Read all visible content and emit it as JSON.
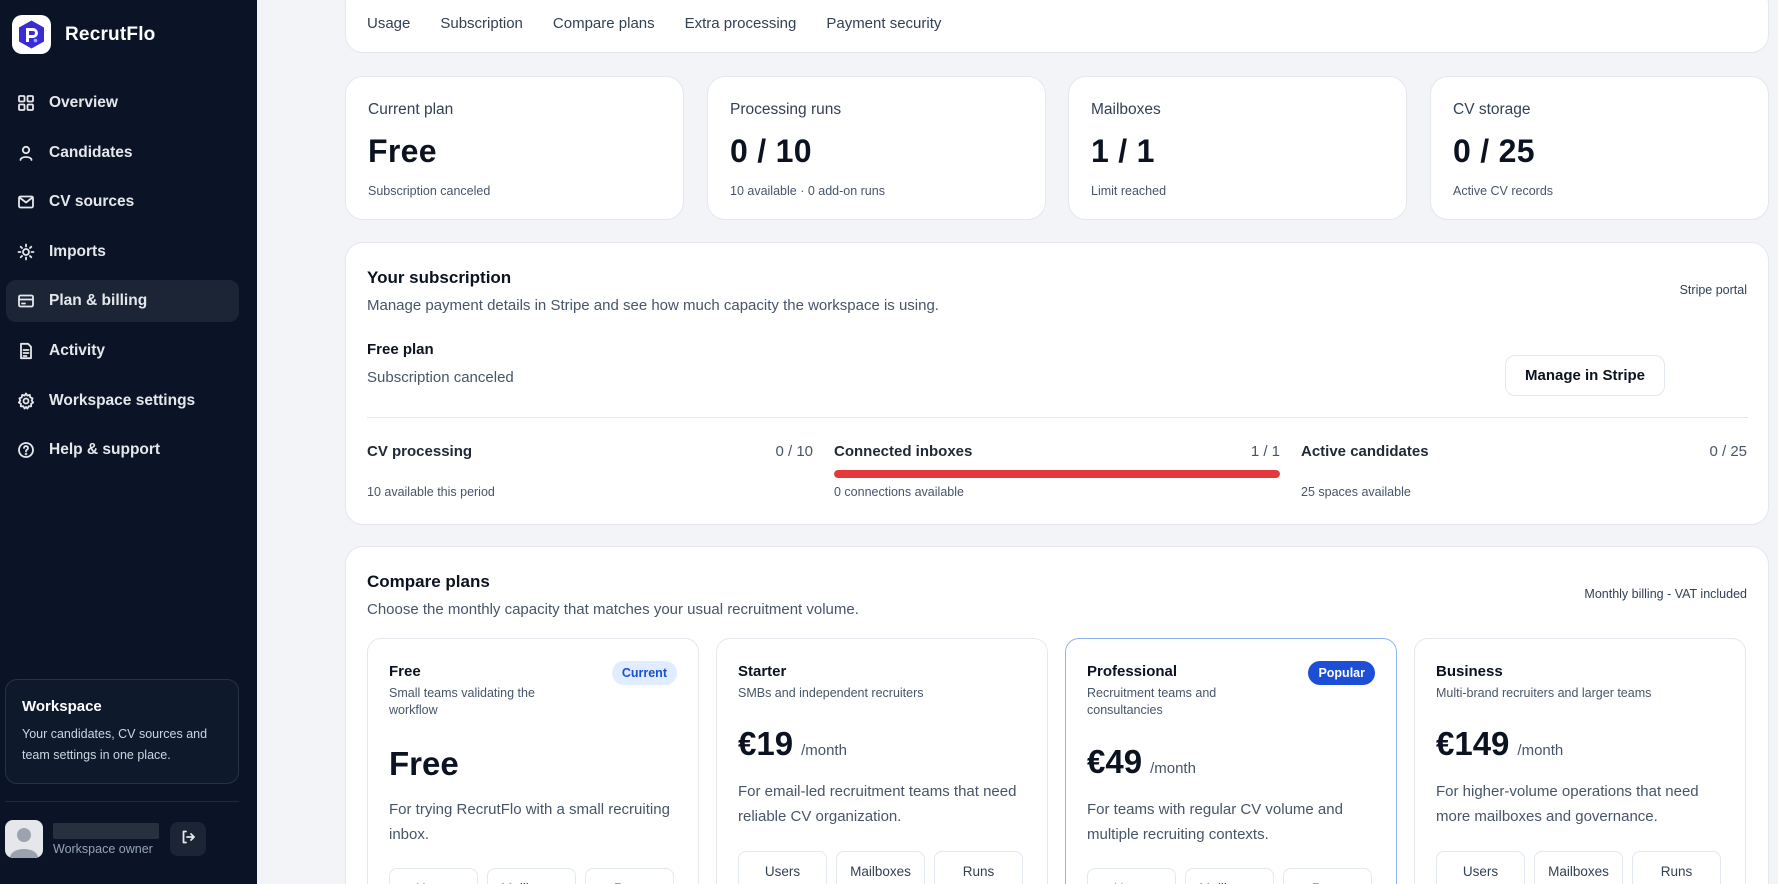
{
  "app": {
    "name": "RecrutFlo"
  },
  "sidebar": {
    "items": [
      {
        "label": "Overview",
        "icon": "grid-icon"
      },
      {
        "label": "Candidates",
        "icon": "user-icon"
      },
      {
        "label": "CV sources",
        "icon": "mail-icon"
      },
      {
        "label": "Imports",
        "icon": "sun-icon"
      },
      {
        "label": "Plan & billing",
        "icon": "card-icon",
        "active": true
      },
      {
        "label": "Activity",
        "icon": "document-icon"
      },
      {
        "label": "Workspace settings",
        "icon": "gear-icon"
      },
      {
        "label": "Help & support",
        "icon": "help-icon"
      }
    ],
    "workspace": {
      "title": "Workspace",
      "description": "Your candidates, CV sources and team settings in one place."
    },
    "user": {
      "role": "Workspace owner"
    }
  },
  "tabs": [
    "Usage",
    "Subscription",
    "Compare plans",
    "Extra processing",
    "Payment security"
  ],
  "stats": [
    {
      "label": "Current plan",
      "value": "Free",
      "sub": "Subscription canceled"
    },
    {
      "label": "Processing runs",
      "value": "0 / 10",
      "sub": "10 available · 0 add-on runs"
    },
    {
      "label": "Mailboxes",
      "value": "1 / 1",
      "sub": "Limit reached"
    },
    {
      "label": "CV storage",
      "value": "0 / 25",
      "sub": "Active CV records"
    }
  ],
  "subscription": {
    "title": "Your subscription",
    "description": "Manage payment details in Stripe and see how much capacity the workspace is using.",
    "portal_label": "Stripe portal",
    "plan_name": "Free plan",
    "plan_status": "Subscription canceled",
    "manage_label": "Manage in Stripe",
    "usage": [
      {
        "label": "CV processing",
        "value": "0 / 10",
        "sub": "10 available this period",
        "fraction": 0.0,
        "color": "#e5e7eb"
      },
      {
        "label": "Connected inboxes",
        "value": "1 / 1",
        "sub": "0 connections available",
        "fraction": 1.0,
        "color": "#e5383b"
      },
      {
        "label": "Active candidates",
        "value": "0 / 25",
        "sub": "25 spaces available",
        "fraction": 0.0,
        "color": "#e5e7eb"
      }
    ]
  },
  "compare": {
    "title": "Compare plans",
    "description": "Choose the monthly capacity that matches your usual recruitment volume.",
    "billing_note": "Monthly billing - VAT included",
    "plans": [
      {
        "name": "Free",
        "desc": "Small teams validating the workflow",
        "badge": "Current",
        "price": "Free",
        "per": "",
        "blurb": "For trying RecrutFlo with a small recruiting inbox.",
        "chips": [
          "Users",
          "Mailboxes",
          "Runs"
        ]
      },
      {
        "name": "Starter",
        "desc": "SMBs and independent recruiters",
        "badge": "",
        "price": "€19",
        "per": "/month",
        "blurb": "For email-led recruitment teams that need reliable CV organization.",
        "chips": [
          "Users",
          "Mailboxes",
          "Runs"
        ]
      },
      {
        "name": "Professional",
        "desc": "Recruitment teams and consultancies",
        "badge": "Popular",
        "price": "€49",
        "per": "/month",
        "blurb": "For teams with regular CV volume and multiple recruiting contexts.",
        "chips": [
          "Users",
          "Mailboxes",
          "Runs"
        ]
      },
      {
        "name": "Business",
        "desc": "Multi-brand recruiters and larger teams",
        "badge": "",
        "price": "€149",
        "per": "/month",
        "blurb": "For higher-volume operations that need more mailboxes and governance.",
        "chips": [
          "Users",
          "Mailboxes",
          "Runs"
        ]
      }
    ]
  },
  "colors": {
    "sidebar_bg": "#0b1426",
    "accent": "#1d4ed8",
    "limit_bar": "#e5383b"
  }
}
